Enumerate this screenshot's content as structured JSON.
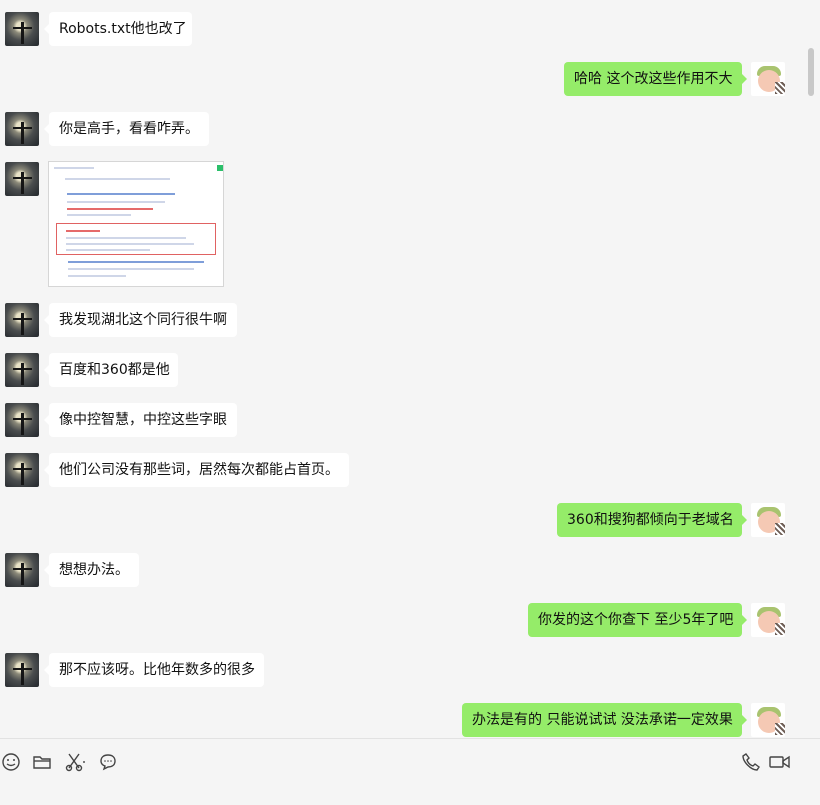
{
  "messages": [
    {
      "side": "left",
      "text": "Robots.txt他也改了"
    },
    {
      "side": "right",
      "text": "哈哈 这个改这些作用不大"
    },
    {
      "side": "left",
      "text": "你是高手，看看咋弄。"
    },
    {
      "side": "left",
      "type": "image",
      "icon": "search-result-screenshot"
    },
    {
      "side": "left",
      "text": "我发现湖北这个同行很牛啊"
    },
    {
      "side": "left",
      "text": "百度和360都是他"
    },
    {
      "side": "left",
      "text": "像中控智慧，中控这些字眼"
    },
    {
      "side": "left",
      "text": "他们公司没有那些词，居然每次都能占首页。"
    },
    {
      "side": "right",
      "text": "360和搜狗都倾向于老域名"
    },
    {
      "side": "left",
      "text": "想想办法。"
    },
    {
      "side": "right",
      "text": "你发的这个你查下 至少5年了吧"
    },
    {
      "side": "left",
      "text": "那不应该呀。比他年数多的很多"
    },
    {
      "side": "right",
      "text": "办法是有的 只能说试试 没法承诺一定效果"
    }
  ],
  "toolbar": {
    "left_icons": [
      "emoji-icon",
      "folder-icon",
      "scissors-icon",
      "chat-bubble-icon"
    ],
    "right_icons": [
      "phone-icon",
      "video-icon"
    ]
  },
  "colors": {
    "outgoing": "#95ec69",
    "incoming": "#ffffff",
    "background": "#f5f5f5"
  }
}
